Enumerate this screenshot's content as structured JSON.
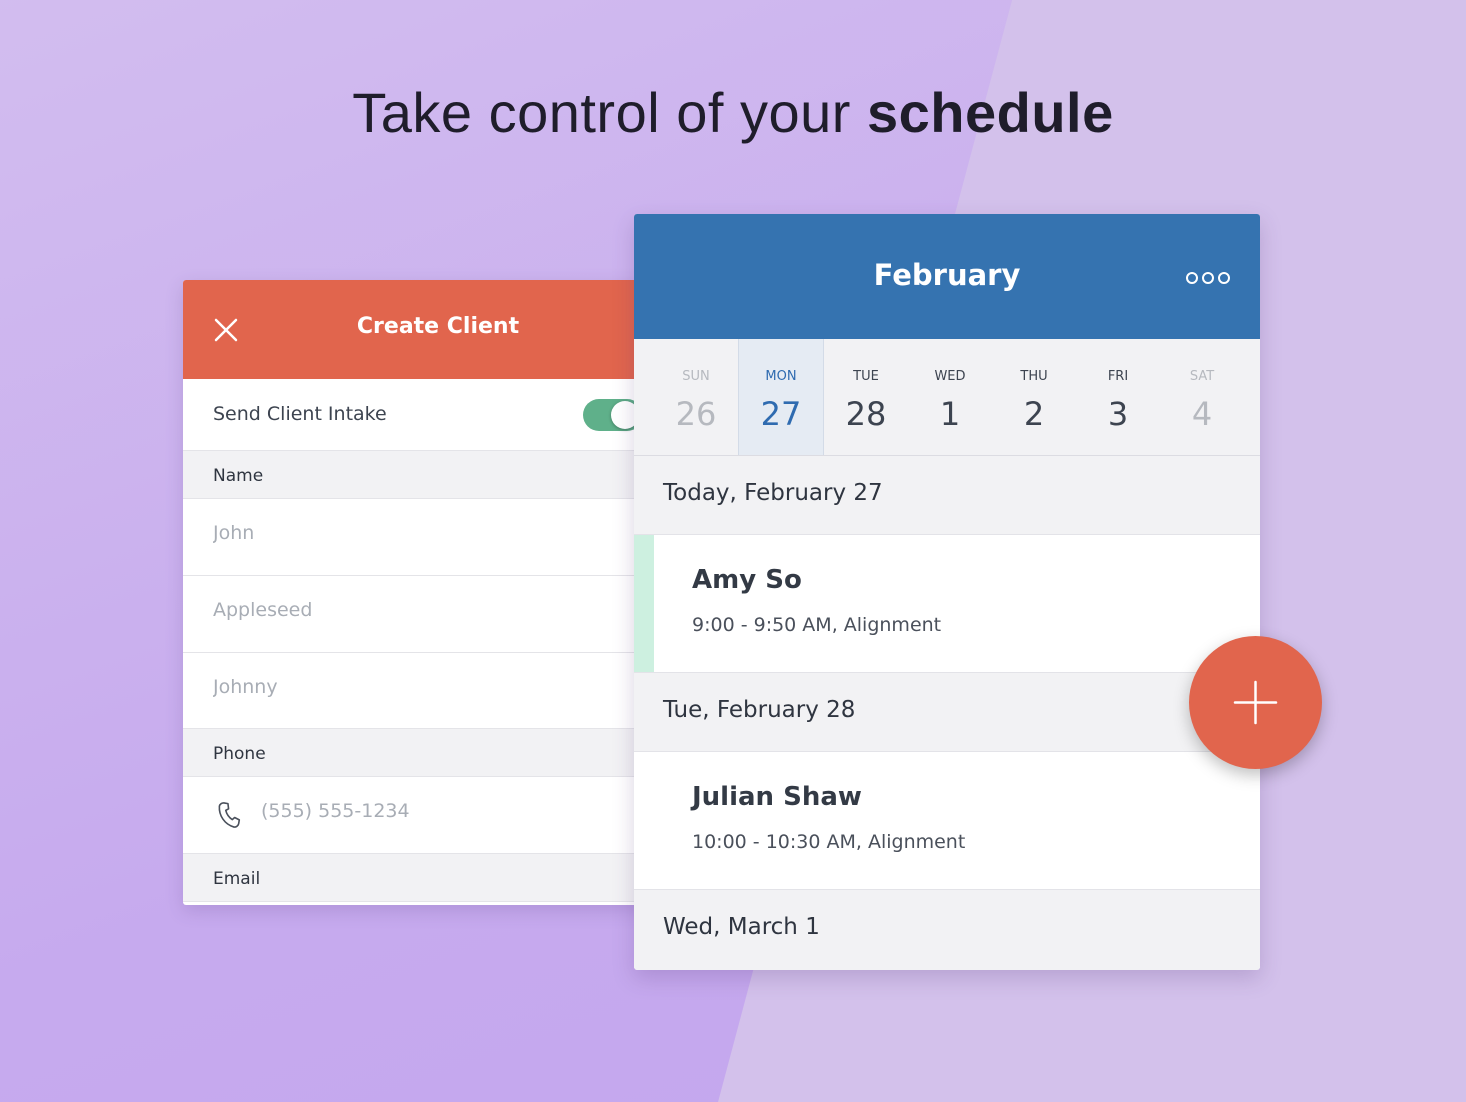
{
  "headline": {
    "regular": "Take control of your ",
    "bold": "schedule"
  },
  "create_client": {
    "title": "Create Client",
    "close_icon": "close-icon",
    "send_intake": {
      "label": "Send Client Intake",
      "enabled": true
    },
    "name_section": {
      "label": "Name",
      "first_placeholder": "John",
      "last_placeholder": "Appleseed",
      "nickname_placeholder": "Johnny"
    },
    "phone_section": {
      "label": "Phone",
      "icon": "phone-icon",
      "placeholder": "(555) 555-1234"
    },
    "email_section": {
      "label": "Email"
    }
  },
  "calendar": {
    "month": "February",
    "more_icon": "more-icon",
    "days": [
      {
        "name": "SUN",
        "num": "26"
      },
      {
        "name": "MON",
        "num": "27"
      },
      {
        "name": "TUE",
        "num": "28"
      },
      {
        "name": "WED",
        "num": "1"
      },
      {
        "name": "THU",
        "num": "2"
      },
      {
        "name": "FRI",
        "num": "3"
      },
      {
        "name": "SAT",
        "num": "4"
      }
    ],
    "agenda": [
      {
        "date": "Today, February 27",
        "appointment": {
          "name": "Amy So",
          "detail": "9:00 - 9:50 AM, Alignment"
        }
      },
      {
        "date": "Tue, February 28",
        "appointment": {
          "name": "Julian Shaw",
          "detail": "10:00 - 10:30 AM, Alignment"
        }
      },
      {
        "date": "Wed, March 1"
      }
    ]
  },
  "fab_icon": "plus-icon",
  "colors": {
    "accent_orange": "#e1654d",
    "header_blue": "#3573b0",
    "toggle_green": "#5fb08a",
    "selected_day": "#2f6bb0"
  }
}
